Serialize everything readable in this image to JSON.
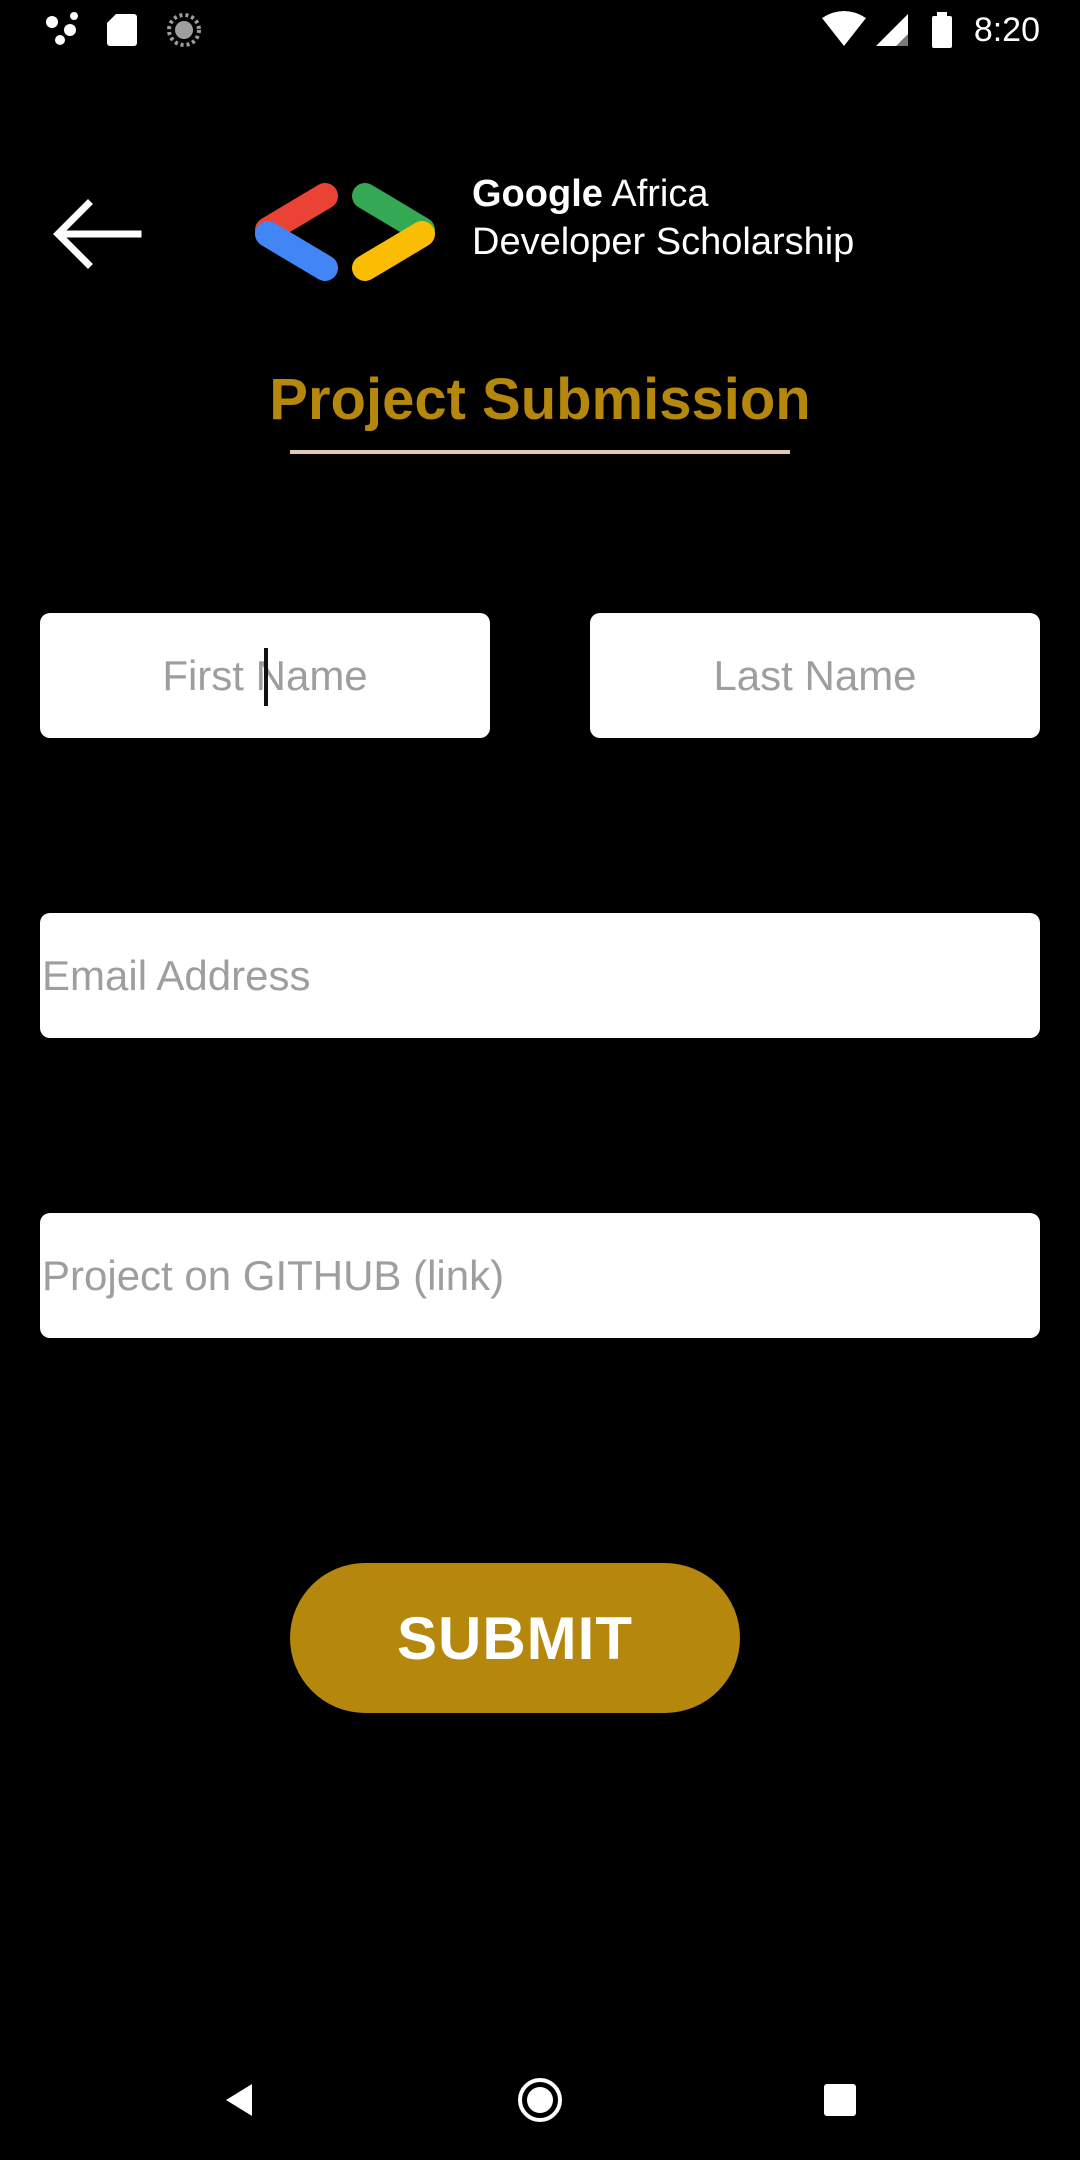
{
  "status_bar": {
    "time": "8:20",
    "left_icons": [
      "assistant-dots-icon",
      "sd-card-icon",
      "sync-spinner-icon"
    ],
    "right_icons": [
      "wifi-icon",
      "cell-signal-icon",
      "battery-icon"
    ]
  },
  "header": {
    "back_icon": "arrow-left-icon",
    "logo": {
      "line1_brand": "Google",
      "line1_rest": "Africa",
      "line2": "Developer Scholarship",
      "colors": [
        "#ea4335",
        "#4285f4",
        "#34a853",
        "#fbbc04"
      ]
    }
  },
  "page": {
    "title": "Project Submission"
  },
  "form": {
    "first_name": {
      "placeholder": "First Name",
      "value": ""
    },
    "last_name": {
      "placeholder": "Last Name",
      "value": ""
    },
    "email": {
      "placeholder": "Email Address",
      "value": ""
    },
    "github": {
      "placeholder": "Project on GITHUB (link)",
      "value": ""
    },
    "submit_label": "SUBMIT"
  },
  "nav_bar": {
    "icons": [
      "nav-back-icon",
      "nav-home-icon",
      "nav-recents-icon"
    ]
  },
  "colors": {
    "background": "#000000",
    "accent": "#b5870c",
    "title_underline": "#e3c8b3",
    "field_background": "#ffffff",
    "placeholder": "#9e9e9e"
  }
}
